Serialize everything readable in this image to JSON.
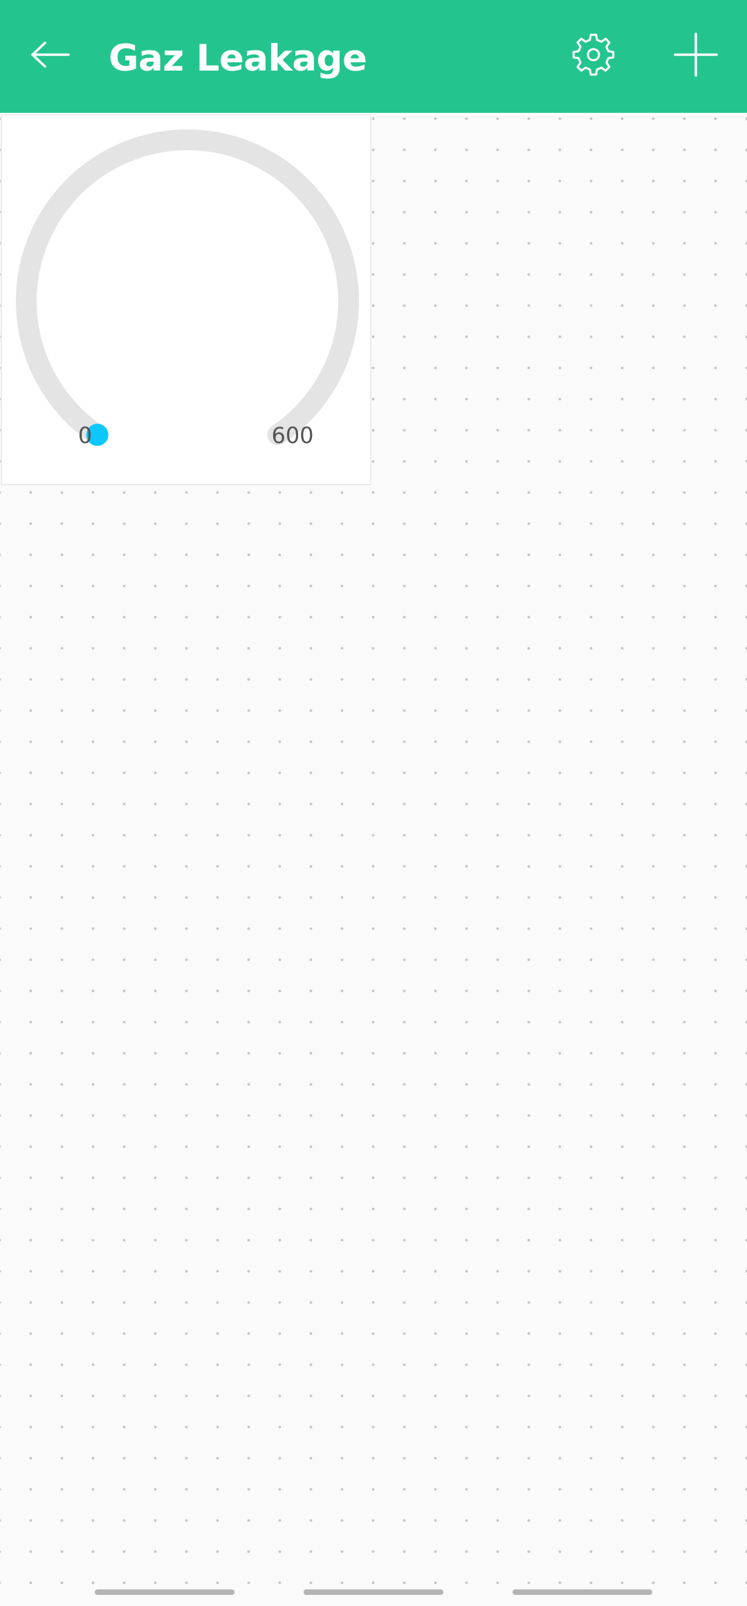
{
  "colors": {
    "app_bar": "#24c48e",
    "gauge_track": "#e4e4e4",
    "gauge_indicator": "#0dc8fd",
    "label_text": "#555555",
    "canvas_background": "#fafafa"
  },
  "app_bar": {
    "title": "Gaz Leakage",
    "back_icon": "arrow-left-icon",
    "settings_icon": "gear-icon",
    "add_icon": "plus-icon"
  },
  "gauge": {
    "min_label": "0",
    "max_label": "600",
    "min": 0,
    "max": 600,
    "value": 0
  },
  "nav_bar": {
    "segments": 3
  }
}
